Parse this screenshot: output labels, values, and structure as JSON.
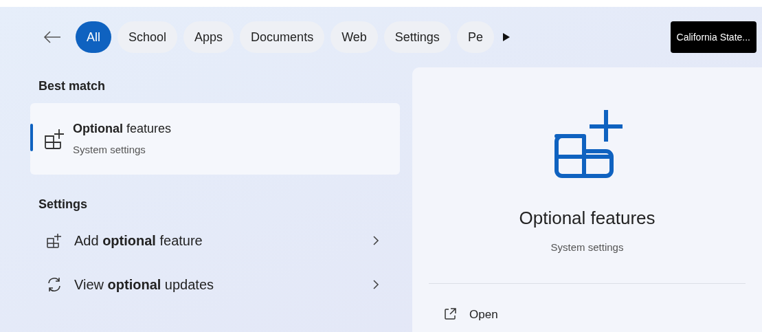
{
  "filters": [
    {
      "label": "All",
      "selected": true
    },
    {
      "label": "School",
      "selected": false
    },
    {
      "label": "Apps",
      "selected": false
    },
    {
      "label": "Documents",
      "selected": false
    },
    {
      "label": "Web",
      "selected": false
    },
    {
      "label": "Settings",
      "selected": false
    },
    {
      "label": "Pe",
      "selected": false
    }
  ],
  "account": "California State...",
  "best_match": {
    "heading": "Best match",
    "item": {
      "title": "**Optional** features",
      "subtitle": "System settings",
      "selected": true
    }
  },
  "settings": {
    "heading": "Settings",
    "items": [
      {
        "kind": "feature",
        "title": "Add **optional** feature"
      },
      {
        "kind": "update",
        "title": "View **optional** updates"
      }
    ]
  },
  "preview": {
    "title": "Optional features",
    "subtitle": "System settings",
    "actions": [
      {
        "label": "Open"
      }
    ]
  }
}
